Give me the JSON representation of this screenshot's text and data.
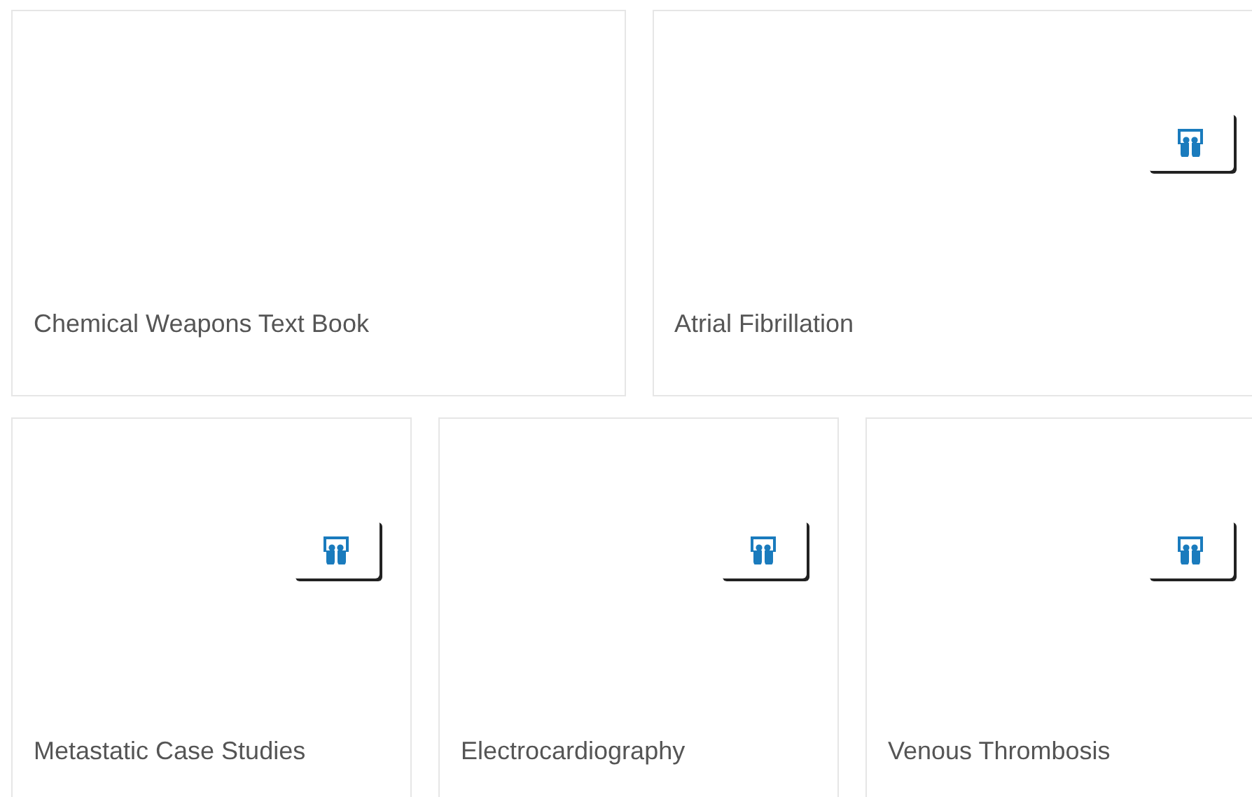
{
  "rows": [
    {
      "cards": [
        {
          "title": "Chemical Weapons Text Book",
          "badge": false
        },
        {
          "title": "Atrial Fibrillation",
          "badge": true
        }
      ]
    },
    {
      "cards": [
        {
          "title": "Metastatic Case Studies",
          "badge": true
        },
        {
          "title": "Electrocardiography",
          "badge": true
        },
        {
          "title": "Venous Thrombosis",
          "badge": true
        }
      ]
    }
  ]
}
